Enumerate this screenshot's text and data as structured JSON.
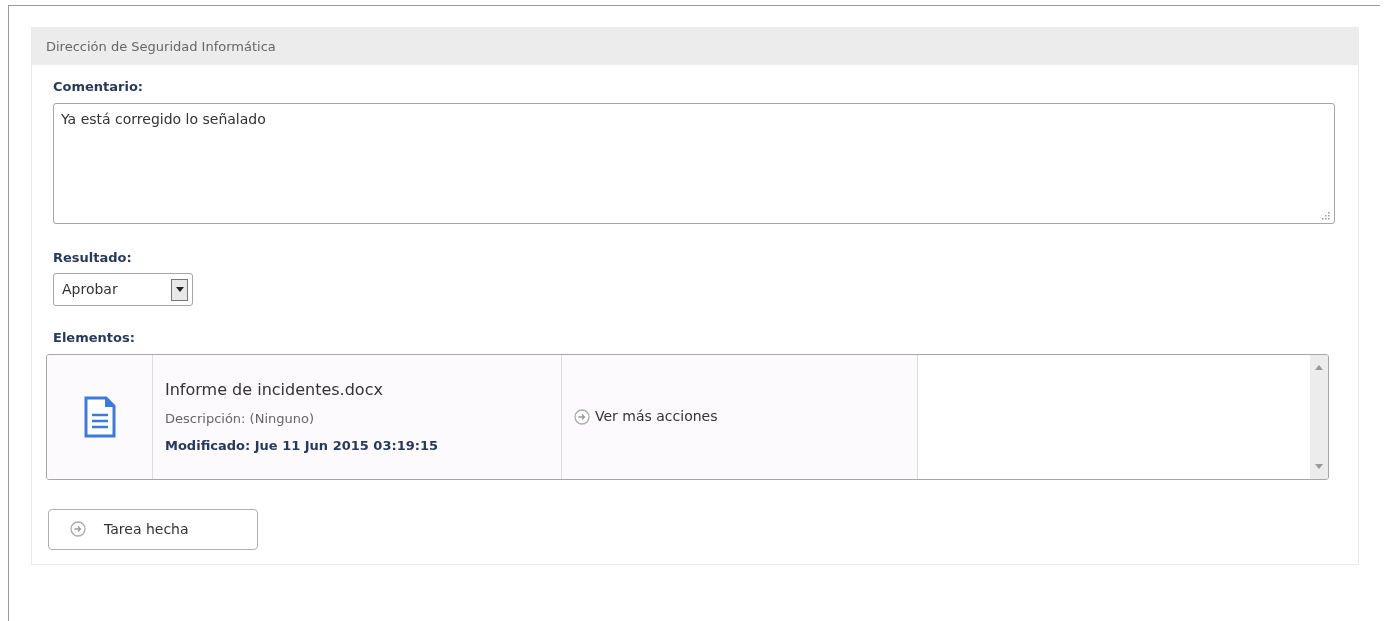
{
  "panel": {
    "title": "Dirección de Seguridad Informática"
  },
  "comment": {
    "label": "Comentario:",
    "value": "Ya está corregido lo señalado"
  },
  "result": {
    "label": "Resultado:",
    "value": "Aprobar"
  },
  "elements": {
    "label": "Elementos:",
    "items": [
      {
        "name": "Informe de incidentes.docx",
        "description": "Descripción: (Ninguno)",
        "modified": "Modificado: Jue 11 Jun 2015 03:19:15",
        "action": "Ver más acciones"
      }
    ]
  },
  "buttons": [
    "Tarea hecha"
  ]
}
